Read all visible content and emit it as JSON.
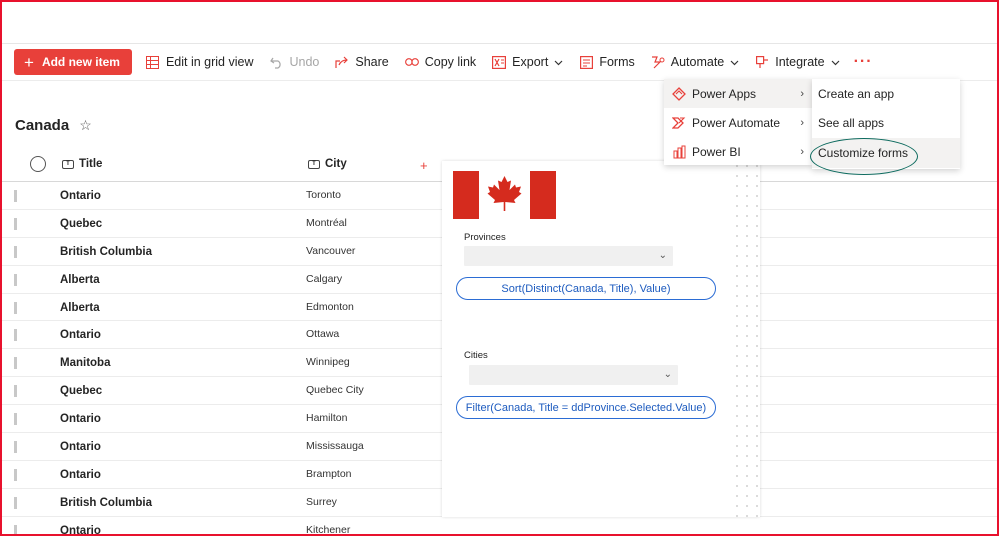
{
  "commandbar": {
    "add_new_item": "Add new item",
    "edit_in_grid_view": "Edit in grid view",
    "undo": "Undo",
    "share": "Share",
    "copy_link": "Copy link",
    "export": "Export",
    "forms": "Forms",
    "automate": "Automate",
    "integrate": "Integrate",
    "more": "···"
  },
  "list": {
    "title": "Canada",
    "columns": {
      "title": "Title",
      "city": "City"
    },
    "rows": [
      {
        "province": "Ontario",
        "city": "Toronto"
      },
      {
        "province": "Quebec",
        "city": "Montréal"
      },
      {
        "province": "British Columbia",
        "city": "Vancouver"
      },
      {
        "province": "Alberta",
        "city": "Calgary"
      },
      {
        "province": "Alberta",
        "city": "Edmonton"
      },
      {
        "province": "Ontario",
        "city": "Ottawa"
      },
      {
        "province": "Manitoba",
        "city": "Winnipeg"
      },
      {
        "province": "Quebec",
        "city": "Quebec City"
      },
      {
        "province": "Ontario",
        "city": "Hamilton"
      },
      {
        "province": "Ontario",
        "city": "Mississauga"
      },
      {
        "province": "Ontario",
        "city": "Brampton"
      },
      {
        "province": "British Columbia",
        "city": "Surrey"
      },
      {
        "province": "Ontario",
        "city": "Kitchener"
      }
    ]
  },
  "form": {
    "provinces_label": "Provinces",
    "provinces_formula": "Sort(Distinct(Canada, Title), Value)",
    "cities_label": "Cities",
    "cities_formula": "Filter(Canada, Title = ddProvince.Selected.Value)"
  },
  "integrate_menu": {
    "items": [
      "Power Apps",
      "Power Automate",
      "Power BI"
    ]
  },
  "powerapps_submenu": {
    "items": [
      "Create an app",
      "See all apps",
      "Customize forms"
    ]
  },
  "colors": {
    "accent": "#e8403a",
    "frame": "#e8112d",
    "highlight_oval": "#0e6b5f",
    "formula_blue": "#1d5bbf",
    "flag_red": "#d52b1e"
  }
}
